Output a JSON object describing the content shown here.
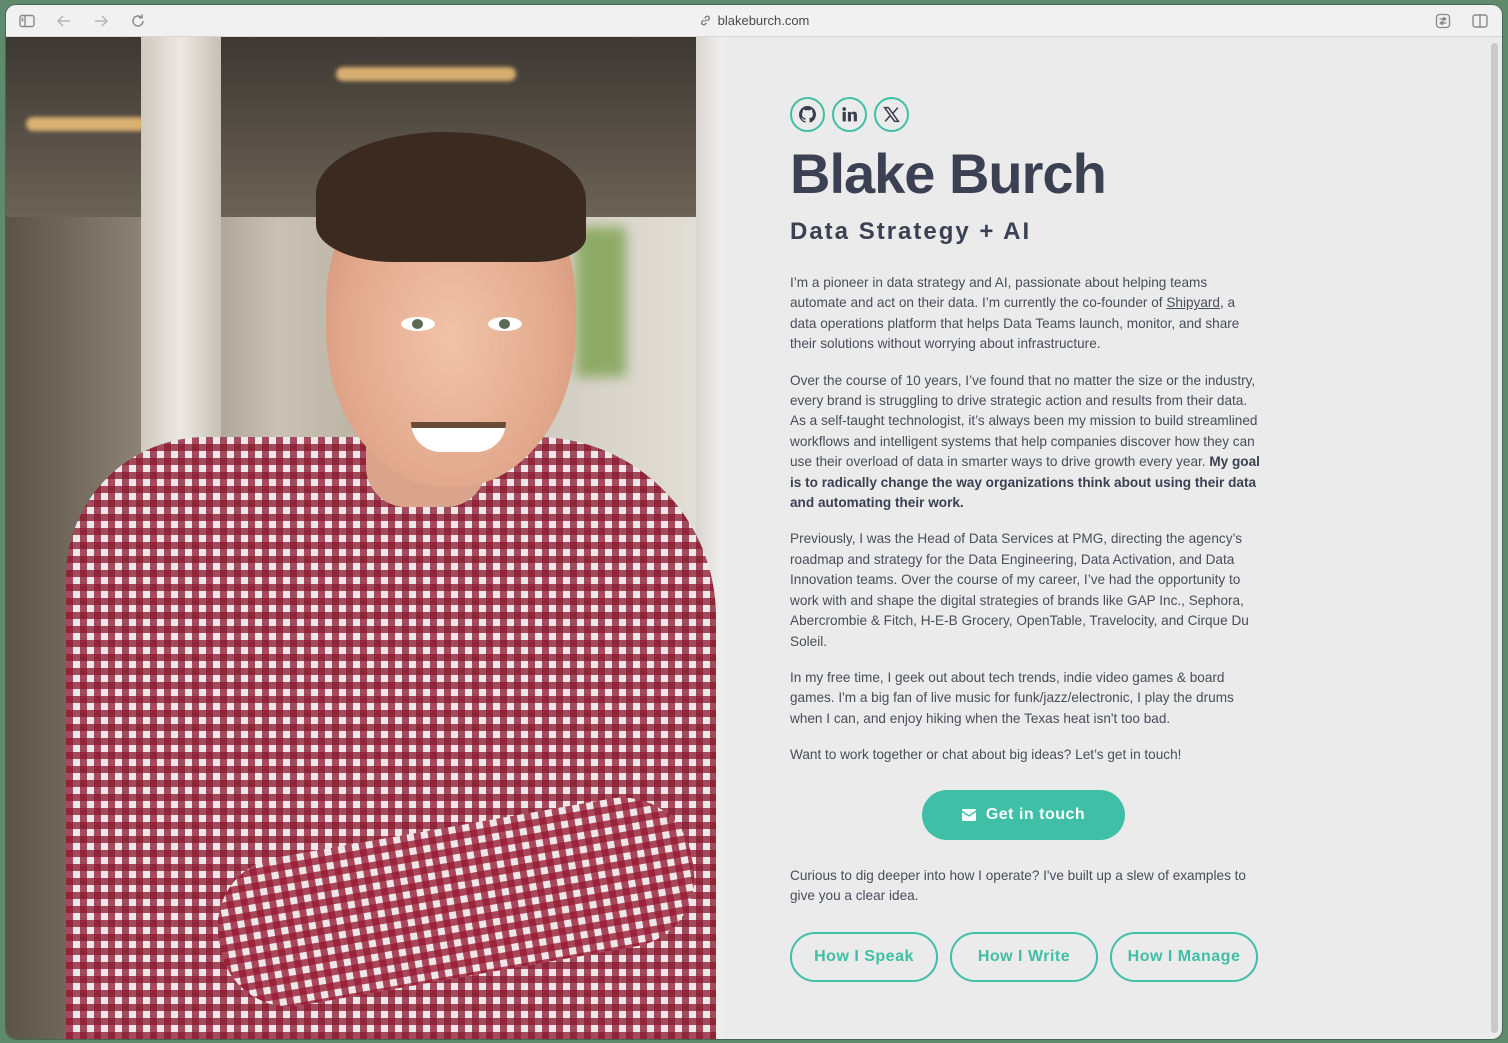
{
  "browser": {
    "url": "blakeburch.com"
  },
  "profile": {
    "name": "Blake Burch",
    "tagline": "Data Strategy + AI"
  },
  "socials": [
    {
      "icon": "github-icon"
    },
    {
      "icon": "linkedin-icon"
    },
    {
      "icon": "x-twitter-icon"
    }
  ],
  "bio": {
    "p1_before_link": "I’m a pioneer in data strategy and AI, passionate about helping teams automate and act on their data. I’m currently the co-founder of ",
    "p1_link": "Shipyard",
    "p1_after_link": ", a data operations platform that helps Data Teams launch, monitor, and share their solutions without worrying about infrastructure.",
    "p2_text": "Over the course of 10 years, I’ve found that no matter the size or the industry, every brand is struggling to drive strategic action and results from their data. As a self-taught technologist, it’s always been my mission to build streamlined workflows and intelligent systems that help companies discover how they can use their overload of data in smarter ways to drive growth every year. ",
    "p2_bold": "My goal is to radically change the way organizations think about using their data and automating their work.",
    "p3": "Previously, I was the Head of Data Services at PMG, directing the agency’s roadmap and strategy for the Data Engineering, Data Activation, and Data Innovation teams. Over the course of my career, I’ve had the opportunity to work with and shape the digital strategies of brands like GAP Inc., Sephora, Abercrombie & Fitch, H-E-B Grocery, OpenTable, Travelocity, and Cirque Du Soleil.",
    "p4": "In my free time, I geek out about tech trends, indie video games & board games. I'm a big fan of live music for funk/jazz/electronic, I play the drums when I can, and enjoy hiking when the Texas heat isn't too bad.",
    "p5": "Want to work together or chat about big ideas? Let’s get in touch!"
  },
  "cta": {
    "label": "Get in touch",
    "icon": "envelope-icon"
  },
  "curious": "Curious to dig deeper into how I operate? I've built up a slew of examples to give you a clear idea.",
  "how_buttons": [
    "How I Speak",
    "How I Write",
    "How I Manage"
  ],
  "colors": {
    "accent": "#3fbfa5",
    "heading": "#3b4052",
    "body_text": "#4a4d5a",
    "page_bg": "#ebebeb"
  }
}
